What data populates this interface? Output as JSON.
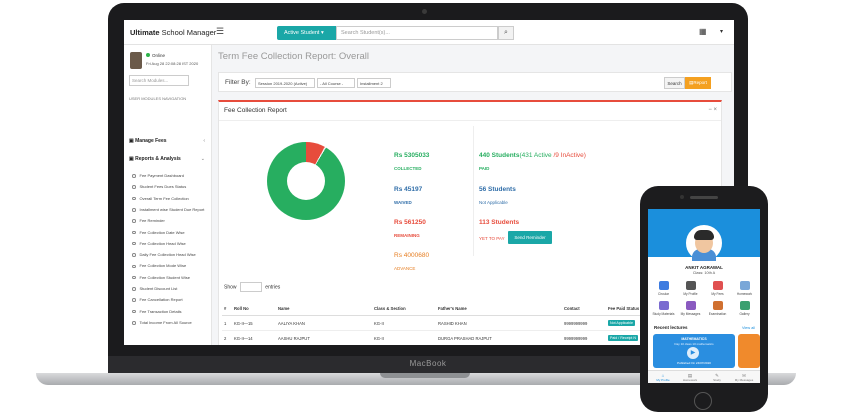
{
  "laptop": {
    "brand": "MacBook"
  },
  "app": {
    "brand_bold": "Ultimate",
    "brand_rest": " School Manager",
    "menu_icon": "☰",
    "active_student": "Active Student",
    "search_placeholder": "Search Student(s)...",
    "grid_icon": "▦",
    "caret_icon": "▾"
  },
  "sidebar": {
    "status": "Online",
    "datetime": "Fri Aug 28 22:08:28 IST 2020",
    "search_placeholder": "Search Modules...",
    "caption": "USER MODULES NAVIGATION",
    "sections": [
      {
        "label": "Manage Fees",
        "chevron": "‹"
      },
      {
        "label": "Reports & Analysis",
        "chevron": "⌄"
      }
    ],
    "items": [
      "Fee Payment Dashboard",
      "Student Fees Dues Status",
      "Overall Term Fee Collection",
      "Installment wise Student Due Report",
      "Fee Reminder",
      "Fee Collection Date Wise",
      "Fee Collection Head Wise",
      "Daily Fee Collection Head Wise",
      "Fee Collection Mode Wise",
      "Fee Collection Student Wise",
      "Student Discount List",
      "Fee Cancellation Report",
      "Fee Transaction Details",
      "Total Income From All Source"
    ]
  },
  "page": {
    "title": "Term Fee Collection Report: Overall",
    "filter_label": "Filter By:",
    "session": "Session 2019-2020 (Active)",
    "course": "- All Course -",
    "installment": "Installment 2",
    "search_btn": "Search",
    "report_btn": "Report"
  },
  "panel": {
    "title": "Fee Collection Report",
    "tools": "−  ×",
    "collected_amt": "Rs 5305033",
    "collected_lbl": "COLLECTED",
    "waived_amt": "Rs 45197",
    "waived_lbl": "WAIVED",
    "remaining_amt": "Rs 561250",
    "remaining_lbl": "REMAINING",
    "advance_amt": "Rs 4000680",
    "advance_lbl": "ADVANCE",
    "paid_count": "440 Students",
    "paid_active": "(431 Active",
    "paid_inactive": " /9 InActive)",
    "paid_lbl": "PAID",
    "na_count": "56 Students",
    "na_lbl": "Not Applicable",
    "ytp_count": "113 Students",
    "ytp_lbl": "YET TO PAY",
    "send_reminder": "Send Reminder",
    "remaining_fraction": 0.08
  },
  "table": {
    "show": "Show",
    "entries": "entries",
    "headers": [
      "#",
      "Roll No",
      "Name",
      "Class & Section",
      "Father's Name",
      "Contact",
      "Fee Paid Status"
    ],
    "rows": [
      [
        "1",
        "KG-II—15",
        "AALIYA KHAN",
        "KG-II",
        "RASHID KHAN",
        "9999999999",
        "Not Applicable"
      ],
      [
        "2",
        "KG-II—14",
        "AASHU RAJPUT",
        "KG-II",
        "DURGA PRASHAD RAJPUT",
        "9999999999",
        "Paid / Receipt N"
      ],
      [
        "3",
        "KG-II—1",
        "AASHVIR NAGAR",
        "KG-II",
        "MOHAN NAGAR",
        "9999999999",
        "Paid / Receipt N"
      ],
      [
        "4",
        "KG-II—7",
        "ABHILASHA JATAV",
        "KG-II",
        "BHAGCHANDRA JATAV",
        "9999999999",
        "Paid / Receipt N"
      ]
    ]
  },
  "phone": {
    "name": "ANKIT AGRAWAL",
    "class": "Class: 10th A",
    "tiles": [
      {
        "label": "Circular",
        "color": "#3d7be0"
      },
      {
        "label": "My Profile",
        "color": "#555"
      },
      {
        "label": "My Fees",
        "color": "#e05050"
      },
      {
        "label": "Homework",
        "color": "#7aa7d8"
      },
      {
        "label": "Study Materials",
        "color": "#7a6bd0"
      },
      {
        "label": "My Messages",
        "color": "#8a5ac0"
      },
      {
        "label": "Examination",
        "color": "#d07030"
      },
      {
        "label": "Gallery",
        "color": "#3aa070"
      }
    ],
    "recent": "Recent lectures",
    "view_all": "View all",
    "card_title": "MATHEMATICS",
    "card_sub": "Day 10 class 10 mathematics",
    "card_date": "Published On 24/07/2020",
    "tabs": [
      {
        "label": "My Profile",
        "icon": "⌂"
      },
      {
        "label": "Homework",
        "icon": "▤"
      },
      {
        "label": "Study",
        "icon": "✎"
      },
      {
        "label": "My Messages",
        "icon": "✉"
      }
    ]
  }
}
